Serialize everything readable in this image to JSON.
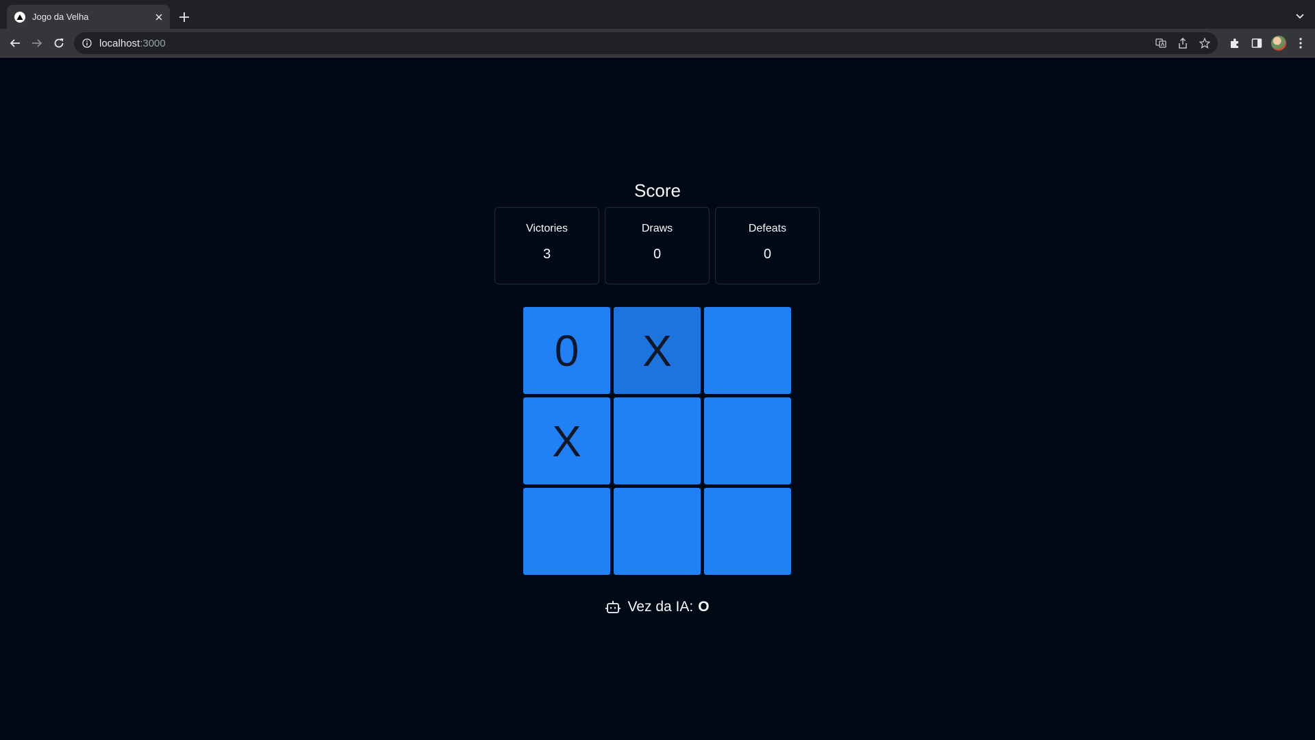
{
  "browser": {
    "tab_title": "Jogo da Velha",
    "url_host": "localhost",
    "url_port": ":3000",
    "icons": [
      "favicon-triangle",
      "close-icon",
      "plus-icon",
      "chevron-down-icon",
      "back-arrow-icon",
      "forward-arrow-icon",
      "reload-icon",
      "info-icon",
      "translate-icon",
      "share-icon",
      "star-icon",
      "puzzle-icon",
      "side-panel-icon",
      "avatar",
      "kebab-menu-icon"
    ]
  },
  "score": {
    "title": "Score",
    "cards": [
      {
        "label": "Victories",
        "value": "3"
      },
      {
        "label": "Draws",
        "value": "0"
      },
      {
        "label": "Defeats",
        "value": "0"
      }
    ]
  },
  "board": {
    "cells": [
      "0",
      "X",
      "",
      "X",
      "",
      "",
      "",
      "",
      ""
    ],
    "colors": {
      "cell": "#2181f4",
      "cell_hover": "#1d74dc",
      "mark": "#0f172a"
    }
  },
  "turn": {
    "label": "Vez da IA:",
    "player": "O",
    "icon": "robot-icon"
  },
  "colors": {
    "page_bg": "#010816",
    "text": "#f8fafc",
    "card_border": "#1e293b"
  }
}
